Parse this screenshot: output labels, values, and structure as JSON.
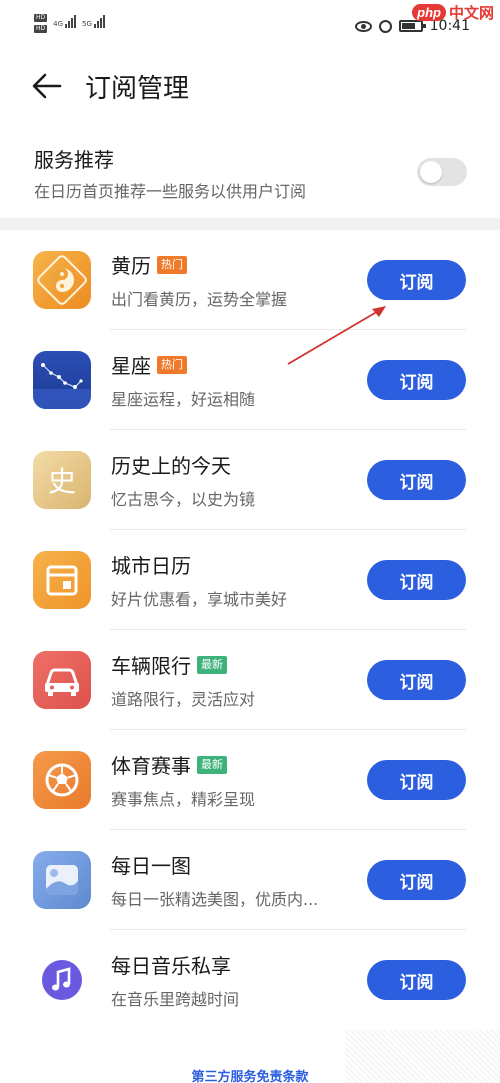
{
  "status_bar": {
    "sim1_tag": "HD",
    "sim2_tag": "HD",
    "net1": "4G",
    "net2": "5G",
    "time": "10:41"
  },
  "watermark": {
    "php": "php",
    "cn": "中文网"
  },
  "header": {
    "title": "订阅管理"
  },
  "service_recommend": {
    "title": "服务推荐",
    "description": "在日历首页推荐一些服务以供用户订阅",
    "enabled": false
  },
  "subscriptions": [
    {
      "name": "黄历",
      "badge": "热门",
      "badge_type": "hot",
      "description": "出门看黄历，运势全掌握",
      "button": "订阅",
      "icon": "yin-yang-icon",
      "icon_color": "#f0a23a"
    },
    {
      "name": "星座",
      "badge": "热门",
      "badge_type": "hot",
      "description": "星座运程，好运相随",
      "button": "订阅",
      "icon": "constellation-icon",
      "icon_color": "#2a4fb0"
    },
    {
      "name": "历史上的今天",
      "badge": "",
      "badge_type": "",
      "description": "忆古思今，以史为镜",
      "button": "订阅",
      "icon": "history-scroll-icon",
      "icon_color": "#e8c98a",
      "icon_text": "史"
    },
    {
      "name": "城市日历",
      "badge": "",
      "badge_type": "",
      "description": "好片优惠看，享城市美好",
      "button": "订阅",
      "icon": "city-calendar-icon",
      "icon_color": "#f0a23a"
    },
    {
      "name": "车辆限行",
      "badge": "最新",
      "badge_type": "new",
      "description": "道路限行，灵活应对",
      "button": "订阅",
      "icon": "car-icon",
      "icon_color": "#e6605a"
    },
    {
      "name": "体育赛事",
      "badge": "最新",
      "badge_type": "new",
      "description": "赛事焦点，精彩呈现",
      "button": "订阅",
      "icon": "football-icon",
      "icon_color": "#f08a3a"
    },
    {
      "name": "每日一图",
      "badge": "",
      "badge_type": "",
      "description": "每日一张精选美图，优质内...",
      "button": "订阅",
      "icon": "photo-icon",
      "icon_color": "#6f9ad8"
    },
    {
      "name": "每日音乐私享",
      "badge": "",
      "badge_type": "",
      "description": "在音乐里跨越时间",
      "button": "订阅",
      "icon": "music-note-icon",
      "icon_color": "#6a5ae0"
    }
  ],
  "footer": {
    "terms_link": "第三方服务免责条款"
  },
  "colors": {
    "accent": "#2c5ee0",
    "hot_badge": "#f07a2a",
    "new_badge": "#3db37b",
    "annotation_arrow": "#d0322e"
  }
}
